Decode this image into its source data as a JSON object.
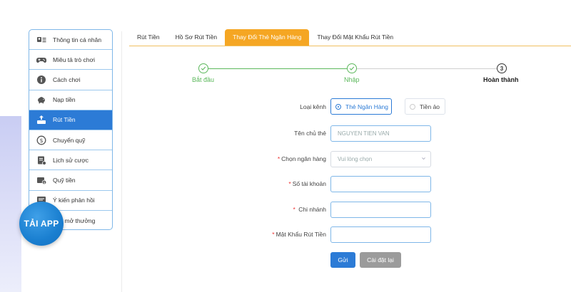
{
  "sidebar": {
    "items": [
      {
        "label": "Thông tin cá nhân",
        "icon": "id-card-icon"
      },
      {
        "label": "Miêu tả trò chơi",
        "icon": "gamepad-icon"
      },
      {
        "label": "Cách chơi",
        "icon": "info-icon"
      },
      {
        "label": "Nạp tiền",
        "icon": "piggy-bank-icon"
      },
      {
        "label": "Rút Tiền",
        "icon": "withdraw-icon",
        "active": true
      },
      {
        "label": "Chuyển quỹ",
        "icon": "dollar-circle-icon"
      },
      {
        "label": "Lịch sử cược",
        "icon": "history-icon"
      },
      {
        "label": "Quỹ tiền",
        "icon": "wallet-icon"
      },
      {
        "label": "Ý kiến phản hồi",
        "icon": "feedback-icon"
      },
      {
        "label": "quả mở thưởng",
        "icon": "result-icon"
      }
    ]
  },
  "app_button": {
    "label": "TẢI APP"
  },
  "tabs": [
    {
      "label": "Rút Tiền"
    },
    {
      "label": "Hồ Sơ Rút Tiền"
    },
    {
      "label": "Thay Đổi Thẻ Ngân Hàng",
      "active": true
    },
    {
      "label": "Thay Đổi Mật Khẩu Rút Tiền"
    }
  ],
  "steps": [
    {
      "label": "Bắt đầu",
      "status": "done"
    },
    {
      "label": "Nhập",
      "status": "done"
    },
    {
      "label": "Hoàn thành",
      "status": "current",
      "number": "3"
    }
  ],
  "form": {
    "channel": {
      "label": "Loại kênh",
      "options": [
        "Thẻ Ngân Hàng",
        "Tiền ảo"
      ],
      "selected": "Thẻ Ngân Hàng"
    },
    "holder": {
      "label": "Tên chủ thẻ",
      "placeholder": "NGUYEN TIEN VAN"
    },
    "bank": {
      "required": "*",
      "label": "Chọn ngân hàng",
      "placeholder": "Vui lòng chọn"
    },
    "account": {
      "required": "*",
      "label": "Số tài khoản",
      "value": ""
    },
    "branch": {
      "required": "*",
      "label": "Chi nhánh",
      "value": ""
    },
    "password": {
      "required": "*",
      "label": "Mật Khẩu Rút Tiền",
      "value": ""
    },
    "submit_label": "Gửi",
    "reset_label": "Cài đặt lại"
  },
  "colors": {
    "accent": "#2c7bd6",
    "tab_active": "#f5a623",
    "step_done": "#5cb85c",
    "required": "#ee3333"
  }
}
